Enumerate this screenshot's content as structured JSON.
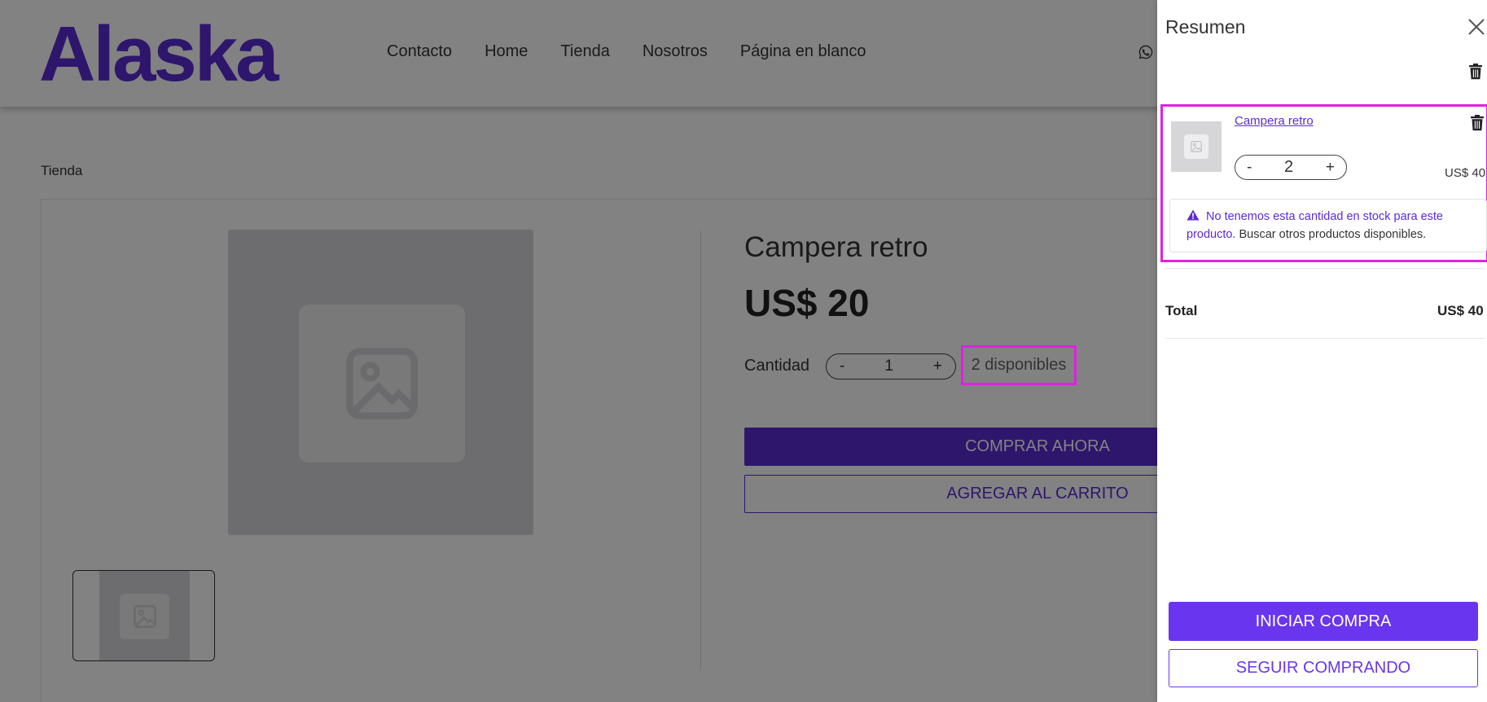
{
  "site": {
    "logo": "Alaska",
    "nav": [
      "Contacto",
      "Home",
      "Tienda",
      "Nosotros",
      "Página en blanco"
    ],
    "breadcrumb": "Tienda",
    "brand_color": "#5b2bd6"
  },
  "product": {
    "title": "Campera retro",
    "price": "US$ 20",
    "quantity_label": "Cantidad",
    "quantity_minus": "-",
    "quantity_value": "1",
    "quantity_plus": "+",
    "stock": "2 disponibles",
    "buy_now": "COMPRAR AHORA",
    "add_to_cart": "AGREGAR AL CARRITO"
  },
  "cart": {
    "title": "Resumen",
    "item": {
      "name": "Campera retro",
      "minus": "-",
      "quantity": "2",
      "plus": "+",
      "price": "US$ 40",
      "alert_text": "No tenemos esta cantidad en stock para este producto.",
      "alert_link": "Buscar otros productos disponibles."
    },
    "total_label": "Total",
    "total_value": "US$ 40",
    "start_purchase": "INICIAR COMPRA",
    "keep_shopping": "SEGUIR COMPRANDO",
    "accent_color": "#6a35ee",
    "highlight_color": "#e020e0"
  }
}
